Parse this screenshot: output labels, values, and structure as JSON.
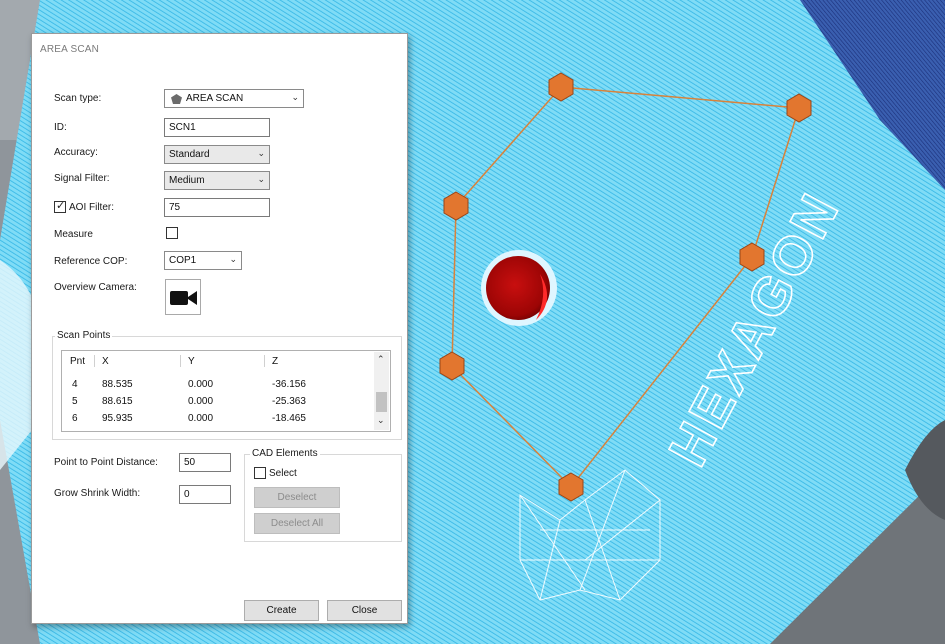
{
  "dialog": {
    "title": "AREA SCAN",
    "scan_type": {
      "label": "Scan type:",
      "value": "AREA SCAN",
      "icon": "area-scan-icon"
    },
    "id": {
      "label": "ID:",
      "value": "SCN1"
    },
    "accuracy": {
      "label": "Accuracy:",
      "value": "Standard"
    },
    "signal_filter": {
      "label": "Signal Filter:",
      "value": "Medium"
    },
    "aoi_filter": {
      "label": "AOI Filter:",
      "value": "75",
      "checked": true
    },
    "measure": {
      "label": "Measure",
      "checked": false
    },
    "reference_cop": {
      "label": "Reference COP:",
      "value": "COP1"
    },
    "overview_camera": {
      "label": "Overview Camera:",
      "icon": "video-camera-icon"
    },
    "scan_points": {
      "title": "Scan Points",
      "columns": [
        "Pnt",
        "X",
        "Y",
        "Z"
      ],
      "rows": [
        [
          "4",
          "88.535",
          "0.000",
          "-36.156"
        ],
        [
          "5",
          "88.615",
          "0.000",
          "-25.363"
        ],
        [
          "6",
          "95.935",
          "0.000",
          "-18.465"
        ]
      ]
    },
    "point_to_point": {
      "label": "Point to Point Distance:",
      "value": "50"
    },
    "grow_shrink": {
      "label": "Grow Shrink Width:",
      "value": "0"
    },
    "cad_elements": {
      "title": "CAD Elements",
      "select_label": "Select",
      "deselect_label": "Deselect",
      "deselect_all_label": "Deselect All"
    },
    "create_label": "Create",
    "close_label": "Close"
  },
  "viewport": {
    "brand_text": "HEXAGON",
    "scan_color": "#5fd3f3",
    "marker_color": "#e2762f",
    "hole_color": "#b50a0a"
  }
}
